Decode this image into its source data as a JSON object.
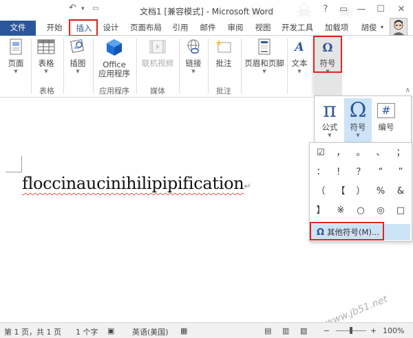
{
  "window": {
    "title": "文档1 [兼容模式] - Microsoft Word",
    "controls": [
      "?",
      "▭",
      "—",
      "☐",
      "✕"
    ]
  },
  "quick_access": {
    "undo": "↶"
  },
  "tabs": [
    "文件",
    "开始",
    "插入",
    "设计",
    "页面布局",
    "引用",
    "邮件",
    "审阅",
    "视图",
    "开发工具",
    "加载项"
  ],
  "active_tab": "插入",
  "user_name": "胡俊",
  "ribbon": {
    "buttons": [
      {
        "id": "page",
        "label": "页面",
        "icon": "page-icon"
      },
      {
        "id": "table",
        "label": "表格",
        "icon": "table-icon"
      },
      {
        "id": "illustrations",
        "label": "插图",
        "icon": "illustrations-icon"
      },
      {
        "id": "office-apps",
        "label": "Office\n应用程序",
        "icon": "office-apps-icon"
      },
      {
        "id": "online-video",
        "label": "联机视频",
        "icon": "online-video-icon",
        "disabled": true
      },
      {
        "id": "link",
        "label": "链接",
        "icon": "link-icon"
      },
      {
        "id": "comment",
        "label": "批注",
        "icon": "comment-icon"
      },
      {
        "id": "header-footer",
        "label": "页眉和页脚",
        "icon": "header-footer-icon"
      },
      {
        "id": "text",
        "label": "文本",
        "icon": "text-icon"
      },
      {
        "id": "symbols",
        "label": "符号",
        "icon": "symbols-icon"
      }
    ],
    "groups": [
      "表格",
      "应用程序",
      "媒体",
      "批注"
    ],
    "collapse_glyph": "∧"
  },
  "symbols_popup": {
    "buttons": [
      {
        "label": "公式",
        "glyph": "π",
        "icon": "pi-icon"
      },
      {
        "label": "符号",
        "glyph": "Ω",
        "icon": "omega-icon"
      },
      {
        "label": "编号",
        "glyph": "#",
        "icon": "number-icon"
      }
    ],
    "grid": [
      [
        "☑",
        "，",
        "。",
        "、",
        "；"
      ],
      [
        "：",
        "！",
        "？",
        "“",
        "”"
      ],
      [
        "（",
        "【",
        "）",
        "%",
        "&"
      ],
      [
        "】",
        "※",
        "○",
        "◎",
        "□"
      ]
    ],
    "more_label": "其他符号(M)..."
  },
  "document": {
    "text": "floccinaucinihilipipification",
    "paragraph_mark": "↵"
  },
  "status": {
    "page": "第 1 页，共 1 页",
    "words": "1 个字",
    "language": "英语(美国)",
    "zoom": "100%",
    "zoom_minus": "−",
    "zoom_plus": "+"
  },
  "watermark": "www.jb51.net",
  "colors": {
    "accent": "#2b579a",
    "highlight_box": "#e3221b",
    "hover": "#cde3f7"
  }
}
